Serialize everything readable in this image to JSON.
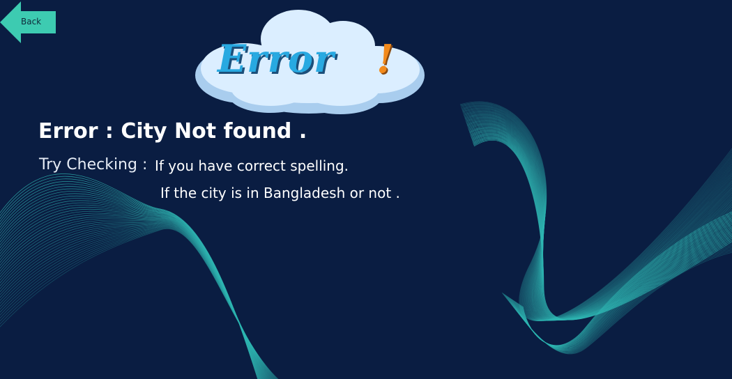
{
  "back_button": {
    "label": "Back",
    "icon": "arrow-left-icon",
    "color": "#3dcbb1"
  },
  "badge": {
    "word": "Error",
    "exclamation": "!",
    "icon": "cloud-icon",
    "word_color": "#28a9e1",
    "bang_color": "#f28a1c"
  },
  "message": {
    "title": "Error : City Not found .",
    "try_label": "Try Checking :",
    "hints": [
      "If you have correct spelling.",
      "If the city is in Bangladesh or not ."
    ]
  },
  "colors": {
    "background": "#0a1d42",
    "wave": "#2fb7b3"
  }
}
